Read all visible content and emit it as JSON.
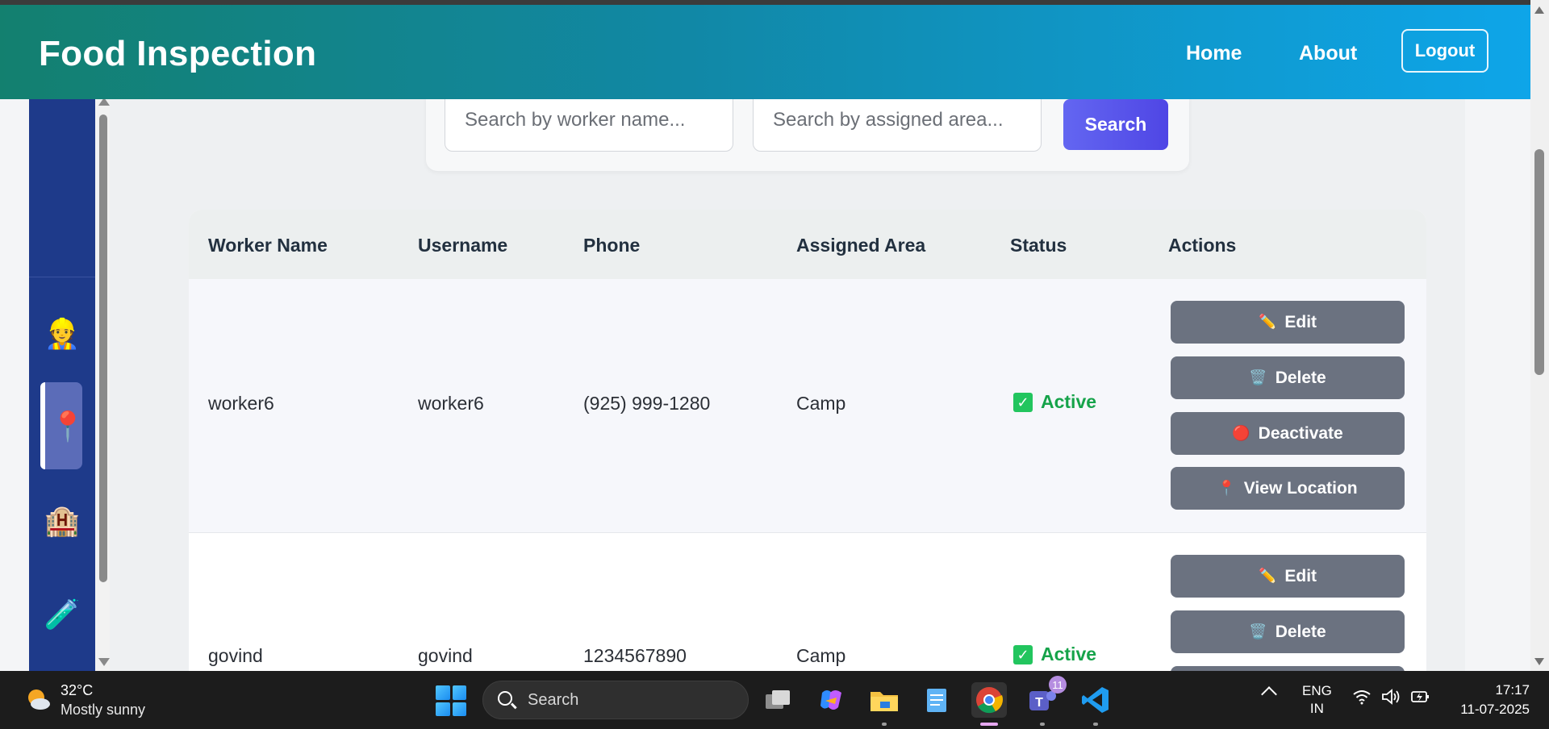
{
  "header": {
    "title": "Food Inspection",
    "nav": {
      "home": "Home",
      "about": "About",
      "logout": "Logout"
    }
  },
  "sidebar": {
    "items": [
      {
        "name": "worker",
        "icon": "👷"
      },
      {
        "name": "location",
        "icon": "📍"
      },
      {
        "name": "hotel",
        "icon": "🏨"
      },
      {
        "name": "lab-test",
        "icon": "🧪"
      }
    ],
    "active_item": "location"
  },
  "search": {
    "worker_placeholder": "Search by worker name...",
    "area_placeholder": "Search by assigned area...",
    "button_label": "Search"
  },
  "table": {
    "columns": [
      "Worker Name",
      "Username",
      "Phone",
      "Assigned Area",
      "Status",
      "Actions"
    ],
    "rows": [
      {
        "worker_name": "worker6",
        "username": "worker6",
        "phone": "(925) 999-1280",
        "area": "Camp",
        "status": "Active",
        "actions": {
          "edit": "Edit",
          "delete": "Delete",
          "deactivate": "Deactivate",
          "view_location": "View Location"
        }
      },
      {
        "worker_name": "govind",
        "username": "govind",
        "phone": "1234567890",
        "area": "Camp",
        "status": "Active",
        "actions": {
          "edit": "Edit",
          "delete": "Delete"
        }
      }
    ]
  },
  "colors": {
    "header_gradient_start": "#13806f",
    "header_gradient_end": "#0ea5e9",
    "sidebar": "#1e3a8a",
    "search_button": "#4f46e5",
    "action_button": "#6b7280",
    "status_active": "#16a34a"
  },
  "taskbar": {
    "weather_temp": "32°C",
    "weather_desc": "Mostly sunny",
    "search_label": "Search",
    "teams_badge": "11",
    "lang_line1": "ENG",
    "lang_line2": "IN",
    "time": "17:17",
    "date": "11-07-2025"
  }
}
